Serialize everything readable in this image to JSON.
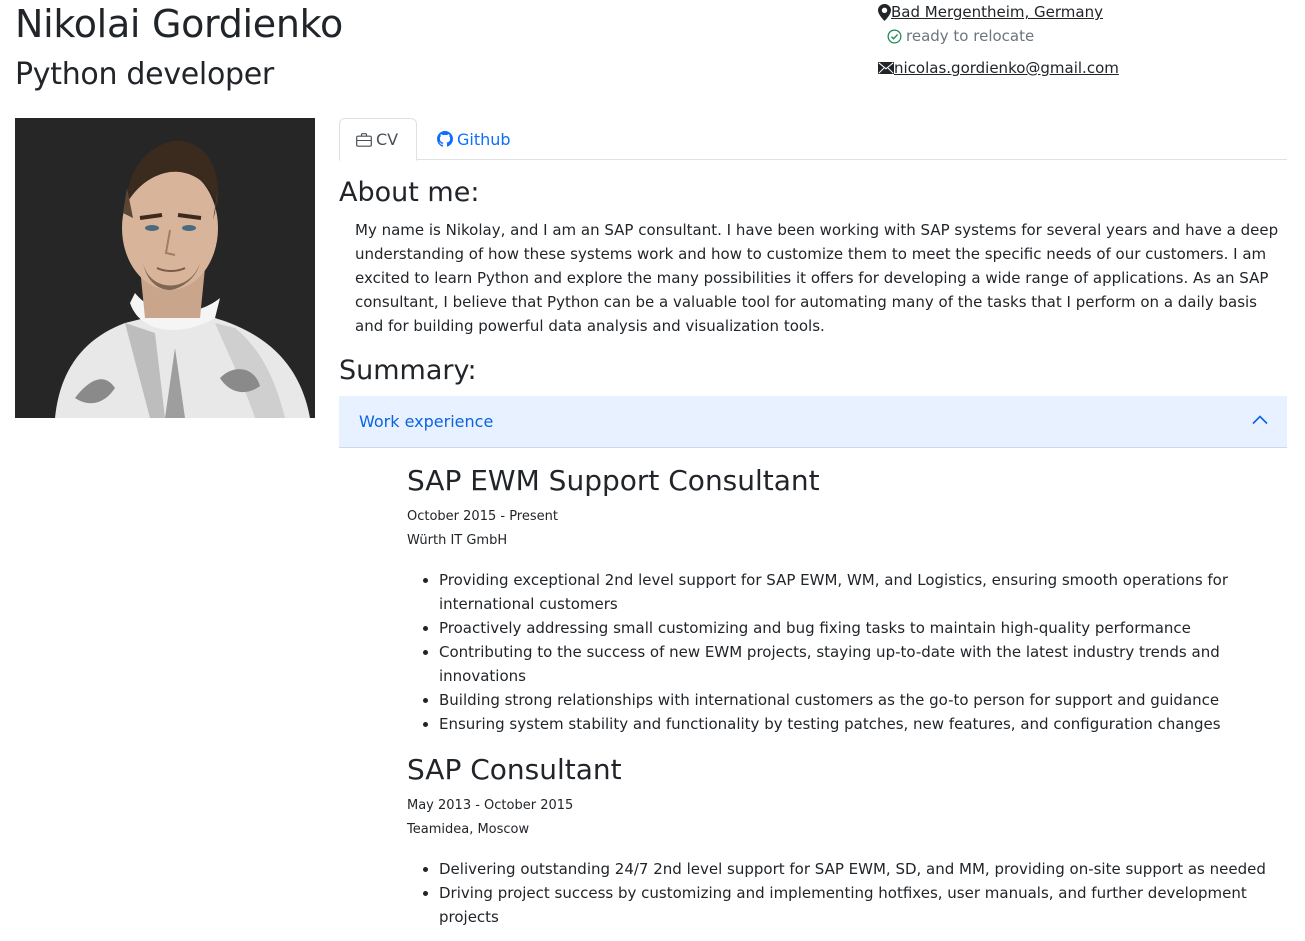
{
  "header": {
    "name": "Nikolai Gordienko",
    "role": "Python developer"
  },
  "contact": {
    "location": " Bad Mergentheim, Germany",
    "relocate": "ready to relocate",
    "email": " nicolas.gordienko@gmail.com",
    "icons": [
      "map-pin-icon",
      "check-circle-icon",
      "envelope-icon"
    ]
  },
  "tabs": [
    {
      "label": "CV",
      "icon": "briefcase-icon",
      "active": true
    },
    {
      "label": "Github",
      "icon": "github-icon",
      "active": false
    }
  ],
  "about": {
    "heading": "About me:",
    "text": "My name is Nikolay, and I am an SAP consultant. I have been working with SAP systems for several years and have a deep understanding of how these systems work and how to customize them to meet the specific needs of our customers. I am excited to learn Python and explore the many possibilities it offers for developing a wide range of applications. As an SAP consultant, I believe that Python can be a valuable tool for automating many of the tasks that I perform on a daily basis and for building powerful data analysis and visualization tools."
  },
  "summary": {
    "heading": "Summary:",
    "accordion_label": "Work experience",
    "jobs": [
      {
        "title": "SAP EWM Support Consultant",
        "period": "October 2015 - Present",
        "company": "Würth IT GmbH",
        "bullets": [
          "Providing exceptional 2nd level support for SAP EWM, WM, and Logistics, ensuring smooth operations for international customers",
          "Proactively addressing small customizing and bug fixing tasks to maintain high-quality performance",
          "Contributing to the success of new EWM projects, staying up-to-date with the latest industry trends and innovations",
          "Building strong relationships with international customers as the go-to person for support and guidance",
          "Ensuring system stability and functionality by testing patches, new features, and configuration changes"
        ]
      },
      {
        "title": "SAP Consultant",
        "period": "May 2013 - October 2015",
        "company": "Teamidea, Moscow",
        "bullets": [
          "Delivering outstanding 24/7 2nd level support for SAP EWM, SD, and MM, providing on-site support as needed",
          "Driving project success by customizing and implementing hotfixes, user manuals, and further development projects"
        ]
      }
    ]
  },
  "colors": {
    "accent": "#0d6efd",
    "accordion_bg": "#e7f1ff",
    "accordion_text": "#0c63e4",
    "check": "#198754"
  }
}
